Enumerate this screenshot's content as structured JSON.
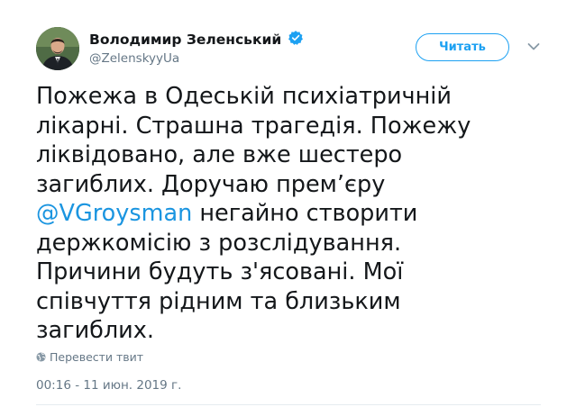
{
  "author": {
    "display_name": "Володимир Зеленський",
    "handle": "@ZelenskyyUa",
    "verified": true,
    "avatar": "avatar-photo"
  },
  "actions": {
    "follow_label": "Читать",
    "menu_icon": "chevron-down-icon"
  },
  "tweet": {
    "lines": [
      "Пожежа в Одеській психіатричній",
      "лікарні. Страшна трагедія. Пожежу",
      "ліквідовано, але вже шестеро",
      "загиблих. Доручаю прем’єру",
      "",
      "держкомісію з розслідування.",
      "Причини будуть з'ясовані. Мої",
      "співчуття рідним та близьким",
      "загиблих."
    ],
    "mention": "@VGroysman",
    "mention_line_rest": " негайно створити"
  },
  "translate": {
    "label": "Перевести твит",
    "icon": "globe-icon"
  },
  "timestamp": "00:16 - 11 июн. 2019 г.",
  "colors": {
    "accent": "#1da1f2",
    "link": "#1b95e0",
    "text": "#14171a",
    "secondary": "#657786",
    "divider": "#e6ecf0"
  }
}
